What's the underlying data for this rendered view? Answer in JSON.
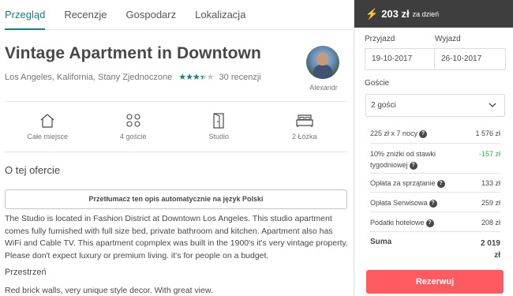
{
  "tabs": [
    {
      "label": "Przegląd",
      "active": true
    },
    {
      "label": "Recenzje"
    },
    {
      "label": "Gospodarz"
    },
    {
      "label": "Lokalizacja"
    }
  ],
  "listing": {
    "title": "Vintage Apartment in Downtown",
    "location": "Los Angeles, Kalifornia, Stany Zjednoczone",
    "rating_stars": 3.5,
    "reviews_count": "30 recenzji"
  },
  "host": {
    "name": "Alexandr"
  },
  "amenities": [
    {
      "icon": "home-icon",
      "label": "Całe miejsce"
    },
    {
      "icon": "guests-icon",
      "label": "4 goście"
    },
    {
      "icon": "door-icon",
      "label": "Studio"
    },
    {
      "icon": "bed-icon",
      "label": "2 Łóżka"
    }
  ],
  "offer": {
    "heading": "O tej ofercie",
    "translate_button": "Przetłumacz ten opis automatycznie na język Polski",
    "description": "The Studio is located in Fashion District at Downtown Los Angeles. This studio apartment comes fully furnished with full size bed, private bathroom and kitchen. Apartment also has WiFi and Cable TV. This apartment copmplex was built in the 1900's it's very vintage property. Please don't expect luxury or premium living. it's for people on a budget.",
    "space_heading": "Przestrzeń",
    "space_text": "Red brick walls, very unique style decor. With great view."
  },
  "booking": {
    "price": "203 zł",
    "per": "za dzień",
    "checkin_label": "Przyjazd",
    "checkout_label": "Wyjazd",
    "checkin_value": "19-10-2017",
    "checkout_value": "26-10-2017",
    "guests_label": "Goście",
    "guests_value": "2 gości",
    "rows": [
      {
        "label": "225 zł x 7 nocy",
        "value": "1 576 zł"
      },
      {
        "label": "10% zniżki od stawki tygodniowej",
        "value": "-157 zł"
      },
      {
        "label": "Opłata za sprzątanie",
        "value": "133 zł"
      },
      {
        "label": "Opłata Serwisowa",
        "value": "259 zł"
      },
      {
        "label": "Podatki hotelowe",
        "value": "208 zł"
      }
    ],
    "total_label": "Suma",
    "total_value": "2 019 zł",
    "reserve_label": "Rezerwuj"
  },
  "colors": {
    "accent": "#127f85",
    "reserve": "#ff5a5f",
    "discount": "#3aa652",
    "price_bar": "#3e3e3e"
  }
}
